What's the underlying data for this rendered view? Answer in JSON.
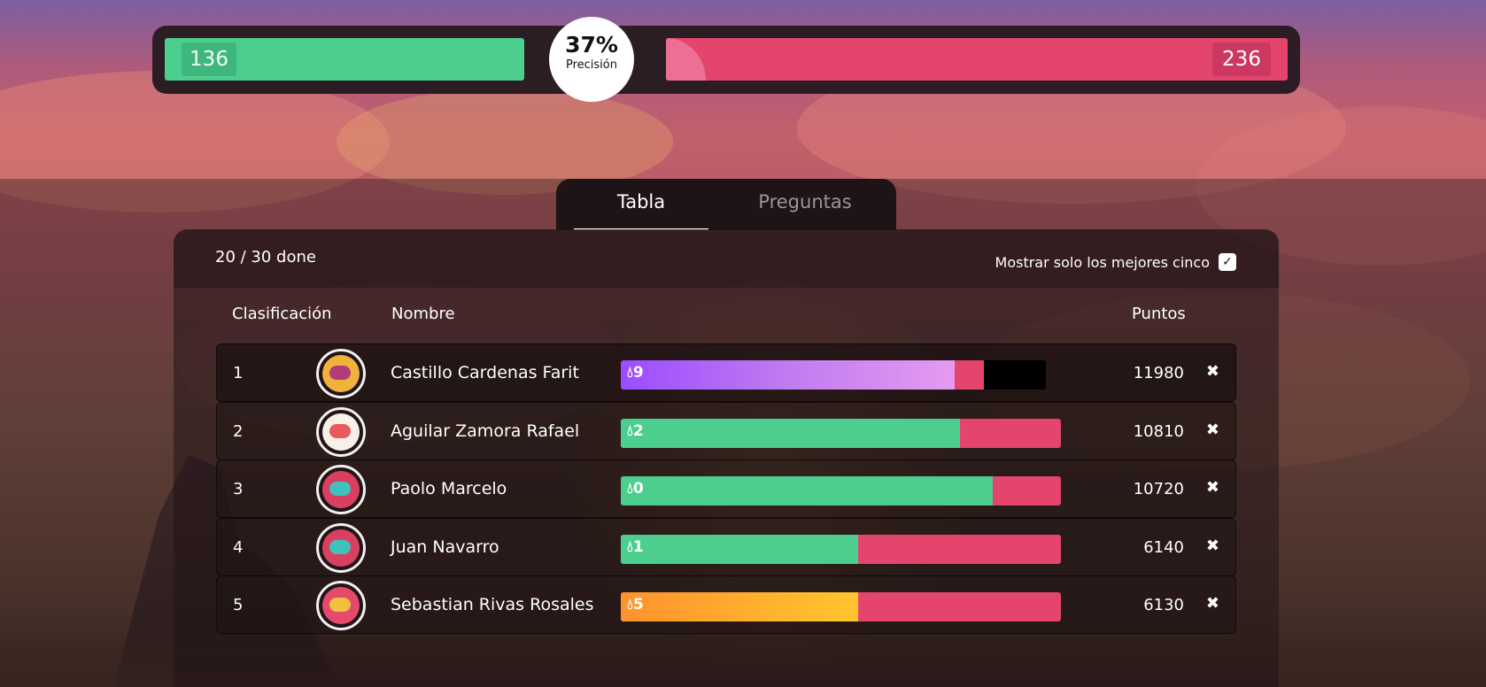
{
  "accuracy": {
    "correct": "136",
    "incorrect": "236",
    "percent": "37%",
    "label": "Precisión",
    "correct_color": "#4bce8e",
    "incorrect_color": "#e4456c"
  },
  "tabs": [
    {
      "label": "Tabla",
      "active": true
    },
    {
      "label": "Preguntas",
      "active": false
    }
  ],
  "board": {
    "progress": "20 / 30 done",
    "top5_label": "Mostrar solo los mejores cinco",
    "top5_checked": true,
    "columns": {
      "rank": "Clasificación",
      "name": "Nombre",
      "points": "Puntos"
    },
    "rows": [
      {
        "rank": "1",
        "name": "Castillo Cardenas Farit",
        "streak": "9",
        "points": "11980",
        "correct_fraction": 0.785,
        "fill": "purple",
        "avatar": "avatar-yellow-mask-icon"
      },
      {
        "rank": "2",
        "name": "Aguilar Zamora Rafael",
        "streak": "2",
        "points": "10810",
        "correct_fraction": 0.77,
        "fill": "green",
        "avatar": "avatar-cyan-bird-icon"
      },
      {
        "rank": "3",
        "name": "Paolo Marcelo",
        "streak": "0",
        "points": "10720",
        "correct_fraction": 0.845,
        "fill": "green",
        "avatar": "avatar-red-cap-icon"
      },
      {
        "rank": "4",
        "name": "Juan Navarro",
        "streak": "1",
        "points": "6140",
        "correct_fraction": 0.54,
        "fill": "green",
        "avatar": "avatar-red-cap-icon"
      },
      {
        "rank": "5",
        "name": "Sebastian Rivas Rosales",
        "streak": "5",
        "points": "6130",
        "correct_fraction": 0.54,
        "fill": "orange",
        "avatar": "avatar-pink-robot-icon"
      }
    ]
  },
  "icons": {
    "streak": "flame-icon",
    "remove": "close-icon",
    "checkbox": "check-icon"
  }
}
